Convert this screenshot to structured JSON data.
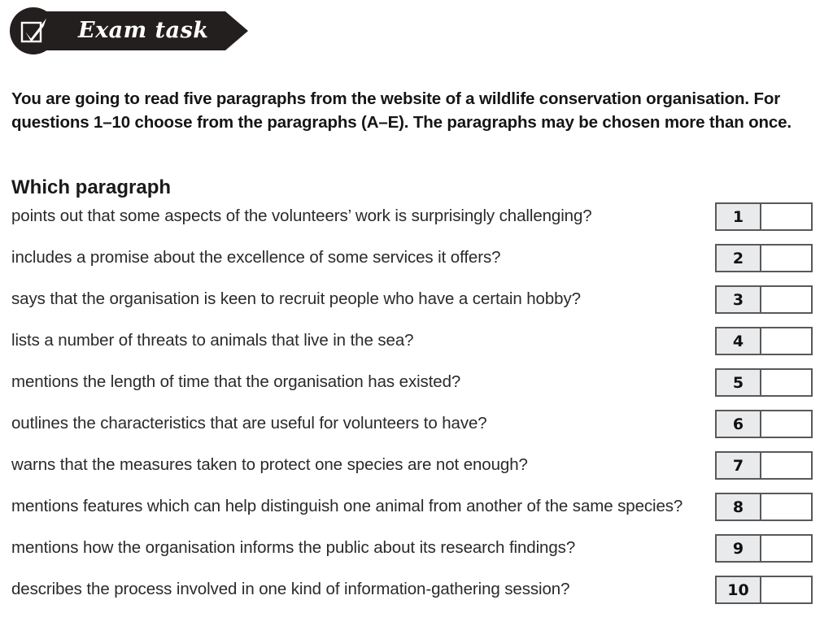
{
  "banner": {
    "title": "Exam task",
    "icon": "checkbox-tick-icon",
    "background_color": "#231f1e",
    "text_color": "#ffffff"
  },
  "instructions": {
    "text": "You are going to read five paragraphs from the website of a wildlife conservation organisation. For questions 1–10 choose from the paragraphs (A–E). The paragraphs may be chosen more than once."
  },
  "section": {
    "heading": "Which paragraph"
  },
  "questions": [
    {
      "number": "1",
      "text": "points out that some aspects of the volunteers’ work is surprisingly challenging?",
      "answer": ""
    },
    {
      "number": "2",
      "text": "includes a promise about the excellence of some services it offers?",
      "answer": ""
    },
    {
      "number": "3",
      "text": "says that the organisation is keen to recruit people who have a certain hobby?",
      "answer": ""
    },
    {
      "number": "4",
      "text": "lists a number of threats to animals that live in the sea?",
      "answer": ""
    },
    {
      "number": "5",
      "text": "mentions the length of time that the organisation has existed?",
      "answer": ""
    },
    {
      "number": "6",
      "text": "outlines the characteristics that are useful for volunteers to have?",
      "answer": ""
    },
    {
      "number": "7",
      "text": "warns that the measures taken to protect one species are not enough?",
      "answer": ""
    },
    {
      "number": "8",
      "text": "mentions features which can help distinguish one animal from another of the same species?",
      "answer": ""
    },
    {
      "number": "9",
      "text": "mentions how the organisation informs the public about its research findings?",
      "answer": ""
    },
    {
      "number": "10",
      "text": "describes the process involved in one kind of information-gathering session?",
      "answer": ""
    }
  ],
  "colors": {
    "answer_box_border": "#59595b",
    "answer_number_fill": "#e9eaeb",
    "answer_field_fill": "#ffffff",
    "page_background": "#ffffff",
    "text": "#1a1a1a"
  }
}
